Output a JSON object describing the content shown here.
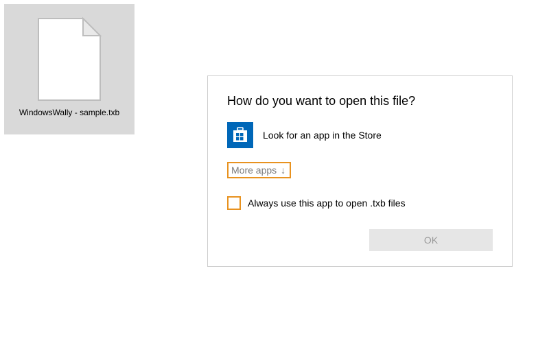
{
  "desktop": {
    "file_label": "WindowsWally - sample.txb"
  },
  "dialog": {
    "title": "How do you want to open this file?",
    "store_option_label": "Look for an app in the Store",
    "more_apps_label": "More apps",
    "checkbox_label": "Always use this app to open .txb files",
    "ok_label": "OK"
  },
  "highlight_color": "#e8921f",
  "store_color": "#0067b8"
}
